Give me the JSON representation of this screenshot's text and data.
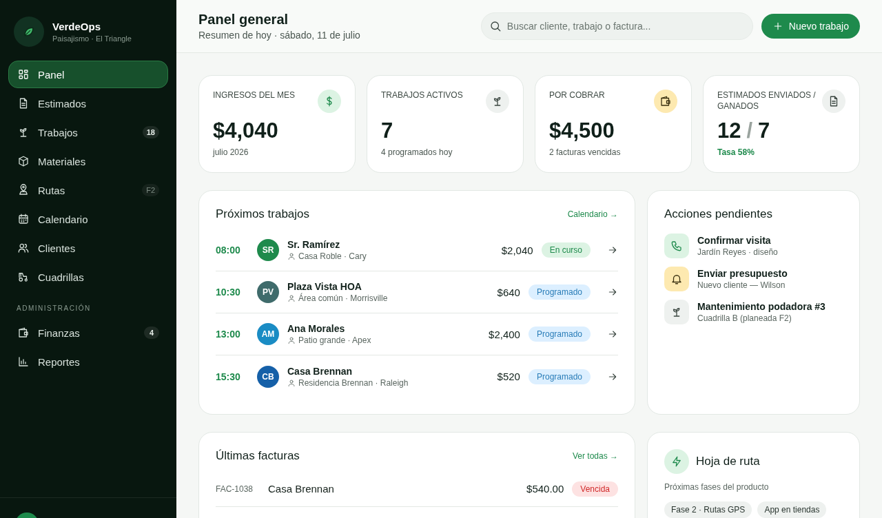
{
  "brand": {
    "name": "VerdeOps",
    "tagline": "Paisajismo · El Triangle"
  },
  "nav": [
    {
      "label": "Panel",
      "selected": true
    },
    {
      "label": "Estimados",
      "selected": false
    },
    {
      "label": "Trabajos",
      "selected": false,
      "badge": {
        "text": "18",
        "muted": false
      }
    },
    {
      "label": "Materiales",
      "selected": false
    },
    {
      "label": "Rutas",
      "selected": false,
      "badge": {
        "text": "F2",
        "muted": true
      }
    },
    {
      "label": "Calendario",
      "selected": false
    },
    {
      "label": "Clientes",
      "selected": false
    },
    {
      "label": "Cuadrillas",
      "selected": false
    }
  ],
  "admin": {
    "heading": "ADMINISTRACIÓN",
    "items": [
      {
        "label": "Finanzas",
        "selected": false,
        "badge": {
          "text": "4",
          "muted": false
        }
      },
      {
        "label": "Reportes",
        "selected": false
      }
    ]
  },
  "header": {
    "title": "Panel general",
    "subtitle": "Resumen de hoy · sábado, 11 de julio",
    "search": {
      "placeholder": "Buscar cliente, trabajo o factura..."
    },
    "new_button": "Nuevo trabajo"
  },
  "stats": [
    {
      "label": "INGRESOS DEL MES",
      "value": "$4,040",
      "note": "julio 2026",
      "kind": "plain"
    },
    {
      "label": "TRABAJOS ACTIVOS",
      "value": "7",
      "note": "4 programados hoy",
      "kind": "plain"
    },
    {
      "label": "POR COBRAR",
      "value": "$4,500",
      "note": "2 facturas vencidas",
      "kind": "plain"
    },
    {
      "label": "ESTIMADOS ENVIADOS / GANADOS",
      "value": "12",
      "separator": "/",
      "value_secondary": "7",
      "note": "Tasa 58%",
      "kind": "positive"
    }
  ],
  "jobs": {
    "title": "Próximos trabajos",
    "link": "Calendario →",
    "rows": [
      {
        "time": "08:00",
        "initials": "SR",
        "color": "#1e8a4c",
        "client": "Sr. Ramírez",
        "place": "Casa Roble · Cary",
        "amount": "$2,040",
        "status": "En curso",
        "kind": "in_progress"
      },
      {
        "time": "10:30",
        "initials": "PV",
        "color": "#3f6b6b",
        "client": "Plaza Vista HOA",
        "place": "Área común · Morrisville",
        "amount": "$640",
        "status": "Programado",
        "kind": "scheduled"
      },
      {
        "time": "13:00",
        "initials": "AM",
        "color": "#1a8cc4",
        "client": "Ana Morales",
        "place": "Patio grande · Apex",
        "amount": "$2,400",
        "status": "Programado",
        "kind": "scheduled"
      },
      {
        "time": "15:30",
        "initials": "CB",
        "color": "#1560a8",
        "client": "Casa Brennan",
        "place": "Residencia Brennan · Raleigh",
        "amount": "$520",
        "status": "Programado",
        "kind": "scheduled"
      }
    ]
  },
  "actions": {
    "title": "Acciones pendientes",
    "items": [
      {
        "title": "Confirmar visita",
        "detail": "Jardín Reyes · diseño"
      },
      {
        "title": "Enviar presupuesto",
        "detail": "Nuevo cliente — Wilson"
      },
      {
        "title": "Mantenimiento podadora #3",
        "detail": "Cuadrilla B (planeada F2)"
      }
    ]
  },
  "invoices": {
    "title": "Últimas facturas",
    "link": "Ver todas →",
    "rows": [
      {
        "number": "FAC-1038",
        "client": "Casa Brennan",
        "amount": "$540.00",
        "status": "Vencida",
        "kind": "overdue"
      }
    ]
  },
  "roadmap": {
    "title": "Hoja de ruta",
    "subtitle": "Próximas fases del producto",
    "tags": [
      "Fase 2 · Rutas GPS",
      "App en tiendas"
    ]
  }
}
